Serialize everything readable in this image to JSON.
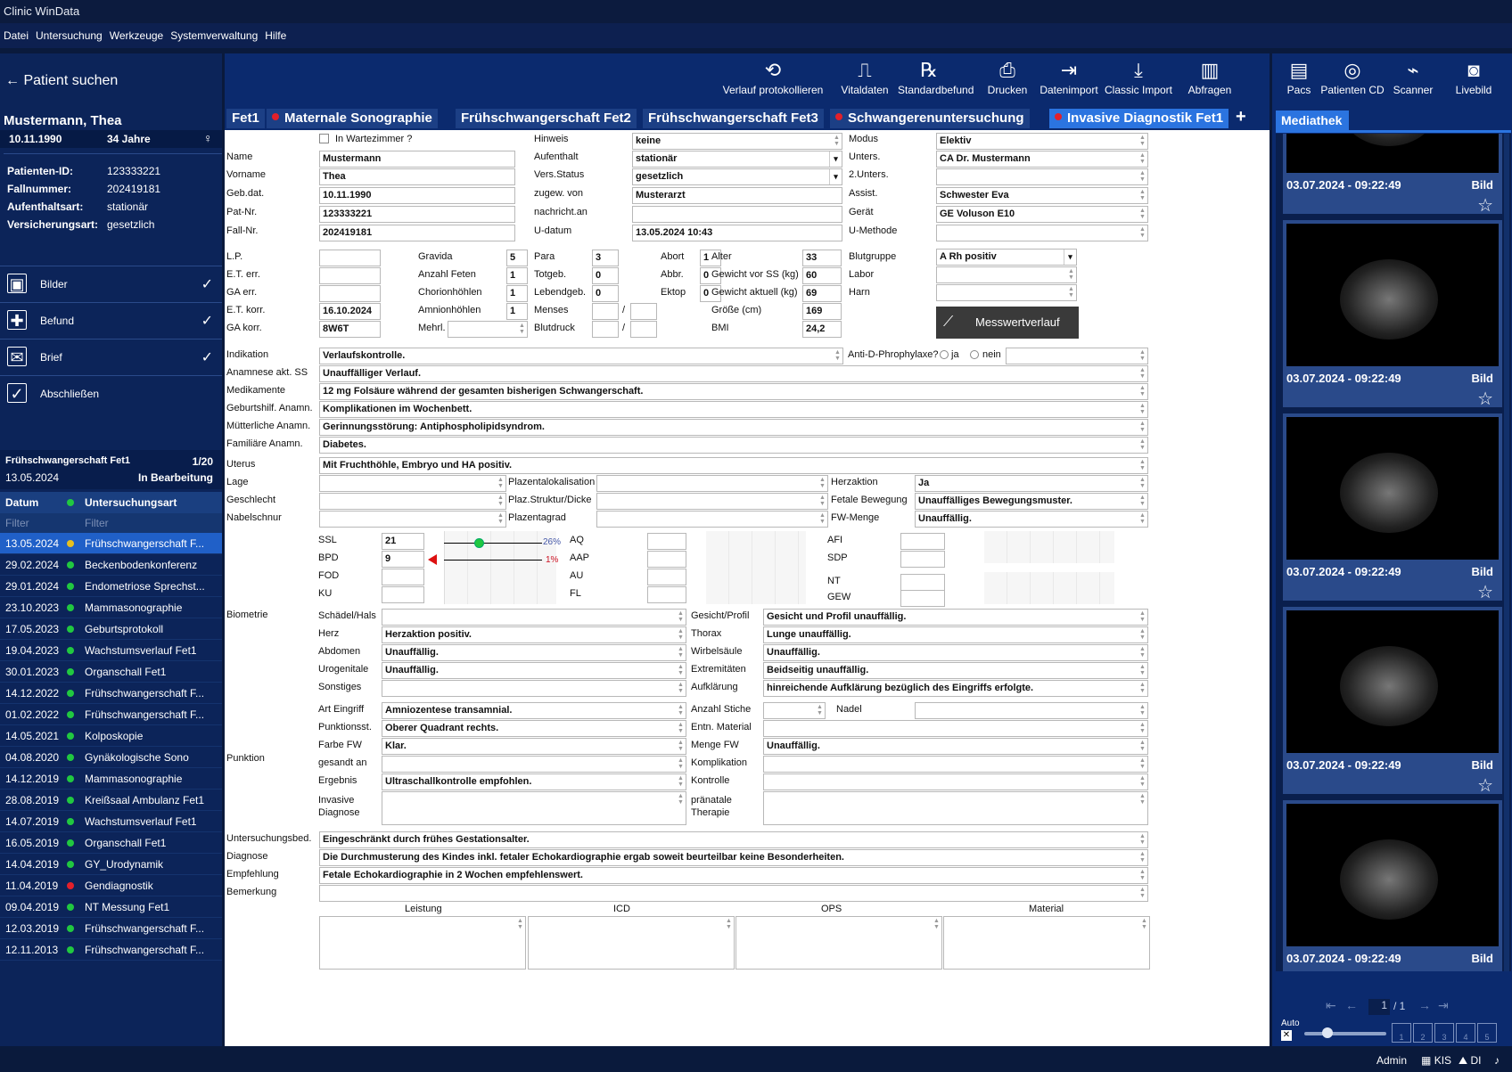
{
  "app": {
    "title": "Clinic WinData"
  },
  "menu": [
    "Datei",
    "Untersuchung",
    "Werkzeuge",
    "Systemverwaltung",
    "Hilfe"
  ],
  "sidebar": {
    "back": "Patient suchen",
    "patient_name": "Mustermann, Thea",
    "dob": "10.11.1990",
    "age": "34 Jahre",
    "details": [
      {
        "label": "Patienten-ID:",
        "value": "123333221"
      },
      {
        "label": "Fallnummer:",
        "value": "202419181"
      },
      {
        "label": "Aufenthaltsart:",
        "value": "stationär"
      },
      {
        "label": "Versicherungsart:",
        "value": "gesetzlich"
      }
    ],
    "nav": [
      {
        "label": "Bilder"
      },
      {
        "label": "Befund"
      },
      {
        "label": "Brief"
      },
      {
        "label": "Abschließen"
      }
    ],
    "visit": {
      "title": "Frühschwangerschaft Fet1",
      "count": "1/20",
      "date": "13.05.2024",
      "status": "In Bearbeitung"
    },
    "history_head": {
      "date": "Datum",
      "type": "Untersuchungsart"
    },
    "filter": "Filter",
    "history": [
      {
        "date": "13.05.2024",
        "type": "Frühschwangerschaft F...",
        "color": "#e6c020"
      },
      {
        "date": "29.02.2024",
        "type": "Beckenbodenkonferenz",
        "color": "#21c840"
      },
      {
        "date": "29.01.2024",
        "type": "Endometriose Sprechst...",
        "color": "#21c840"
      },
      {
        "date": "23.10.2023",
        "type": "Mammasonographie",
        "color": "#21c840"
      },
      {
        "date": "17.05.2023",
        "type": "Geburtsprotokoll",
        "color": "#21c840"
      },
      {
        "date": "19.04.2023",
        "type": "Wachstumsverlauf Fet1",
        "color": "#21c840"
      },
      {
        "date": "30.01.2023",
        "type": "Organschall Fet1",
        "color": "#21c840"
      },
      {
        "date": "14.12.2022",
        "type": "Frühschwangerschaft F...",
        "color": "#21c840"
      },
      {
        "date": "01.02.2022",
        "type": "Frühschwangerschaft F...",
        "color": "#21c840"
      },
      {
        "date": "14.05.2021",
        "type": "Kolposkopie",
        "color": "#21c840"
      },
      {
        "date": "04.08.2020",
        "type": "Gynäkologische Sono",
        "color": "#21c840"
      },
      {
        "date": "14.12.2019",
        "type": "Mammasonographie",
        "color": "#21c840"
      },
      {
        "date": "28.08.2019",
        "type": "Kreißsaal Ambulanz Fet1",
        "color": "#21c840"
      },
      {
        "date": "14.07.2019",
        "type": "Wachstumsverlauf Fet1",
        "color": "#21c840"
      },
      {
        "date": "16.05.2019",
        "type": "Organschall Fet1",
        "color": "#21c840"
      },
      {
        "date": "14.04.2019",
        "type": "GY_Urodynamik",
        "color": "#21c840"
      },
      {
        "date": "11.04.2019",
        "type": "Gendiagnostik",
        "color": "#e3202a"
      },
      {
        "date": "09.04.2019",
        "type": "NT Messung Fet1",
        "color": "#21c840"
      },
      {
        "date": "12.03.2019",
        "type": "Frühschwangerschaft F...",
        "color": "#21c840"
      },
      {
        "date": "12.11.2013",
        "type": "Frühschwangerschaft F...",
        "color": "#21c840"
      }
    ]
  },
  "toolbar": [
    {
      "label": "Verlauf protokollieren",
      "icon": "history-icon",
      "g": "⟲"
    },
    {
      "label": "Vitaldaten",
      "icon": "vitals-icon",
      "g": "⎍"
    },
    {
      "label": "Standardbefund",
      "icon": "prescription-icon",
      "g": "℞"
    },
    {
      "label": "Drucken",
      "icon": "printer-icon",
      "g": "⎙"
    },
    {
      "label": "Datenimport",
      "icon": "import-icon",
      "g": "⇥"
    },
    {
      "label": "Classic Import",
      "icon": "download-icon",
      "g": "⤓"
    },
    {
      "label": "Abfragen",
      "icon": "chart-icon",
      "g": "▥"
    }
  ],
  "right_toolbar": [
    {
      "label": "Pacs",
      "icon": "pacs-icon",
      "g": "▤"
    },
    {
      "label": "Patienten CD",
      "icon": "cd-icon",
      "g": "◎"
    },
    {
      "label": "Scanner",
      "icon": "scanner-icon",
      "g": "⌁"
    },
    {
      "label": "Livebild",
      "icon": "camera-icon",
      "g": "◙"
    }
  ],
  "tabs": [
    {
      "label": "Fet1",
      "dot": false
    },
    {
      "label": "Maternale Sonographie",
      "dot": true
    },
    {
      "label": "Frühschwangerschaft Fet2",
      "dot": false
    },
    {
      "label": "Frühschwangerschaft Fet3",
      "dot": false
    },
    {
      "label": "Schwangerenuntersuchung",
      "dot": true
    },
    {
      "label": "Invasive Diagnostik Fet1",
      "dot": true
    }
  ],
  "form": {
    "wartezimmer": "In Wartezimmer ?",
    "name_l": "Name",
    "name": "Mustermann",
    "vorname_l": "Vorname",
    "vorname": "Thea",
    "gebdat_l": "Geb.dat.",
    "gebdat": "10.11.1990",
    "patnr_l": "Pat-Nr.",
    "patnr": "123333221",
    "fallnr_l": "Fall-Nr.",
    "fallnr": "202419181",
    "hinweis_l": "Hinweis",
    "hinweis": "keine",
    "aufenthalt_l": "Aufenthalt",
    "aufenthalt": "stationär",
    "vers_l": "Vers.Status",
    "vers": "gesetzlich",
    "zugew_l": "zugew. von",
    "zugew": "Musterarzt",
    "nachricht_l": "nachricht.an",
    "nachricht": "",
    "udatum_l": "U-datum",
    "udatum": "13.05.2024 10:43",
    "modus_l": "Modus",
    "modus": "Elektiv",
    "unters_l": "Unters.",
    "unters": "CA Dr. Mustermann",
    "unters2_l": "2.Unters.",
    "unters2": "",
    "assist_l": "Assist.",
    "assist": "Schwester Eva",
    "geraet_l": "Gerät",
    "geraet": "GE Voluson E10",
    "umethode_l": "U-Methode",
    "umethode": "",
    "lp_l": "L.P.",
    "eterr_l": "E.T. err.",
    "gaerr_l": "GA err.",
    "etkorr_l": "E.T. korr.",
    "etkorr": "16.10.2024",
    "gakorr_l": "GA korr.",
    "gakorr": "8W6T",
    "gravida_l": "Gravida",
    "gravida": "5",
    "feten_l": "Anzahl Feten",
    "feten": "1",
    "chorion_l": "Chorionhöhlen",
    "chorion": "1",
    "amnion_l": "Amnionhöhlen",
    "amnion": "1",
    "mehrl_l": "Mehrl.",
    "para_l": "Para",
    "para": "3",
    "totgeb_l": "Totgeb.",
    "totgeb": "0",
    "lebend_l": "Lebendgeb.",
    "lebend": "0",
    "menses_l": "Menses",
    "blutdruck_l": "Blutdruck",
    "abort_l": "Abort",
    "abort": "1",
    "abbr_l": "Abbr.",
    "abbr": "0",
    "ektop_l": "Ektop",
    "ektop": "0",
    "alter_l": "Alter",
    "alter": "33",
    "gewss_l": "Gewicht vor SS (kg)",
    "gewss": "60",
    "gewakt_l": "Gewicht aktuell (kg)",
    "gewakt": "69",
    "groesse_l": "Größe (cm)",
    "groesse": "169",
    "bmi_l": "BMI",
    "bmi": "24,2",
    "blutgruppe_l": "Blutgruppe",
    "blutgruppe": "A Rh positiv",
    "labor_l": "Labor",
    "harn_l": "Harn",
    "messwert": "Messwertverlauf",
    "indikation_l": "Indikation",
    "indikation": "Verlaufskontrolle.",
    "antid_l": "Anti-D-Phrophylaxe?",
    "ja": "ja",
    "nein": "nein",
    "anamnese_l": "Anamnese akt. SS",
    "anamnese": "Unauffälliger Verlauf.",
    "medikamente_l": "Medikamente",
    "medikamente": "12 mg Folsäure während der gesamten bisherigen Schwangerschaft.",
    "geburtshilf_l": "Geburtshilf. Anamn.",
    "geburtshilf": "Komplikationen im Wochenbett.",
    "muetter_l": "Mütterliche Anamn.",
    "muetter": "Gerinnungsstörung: Antiphospholipidsyndrom.",
    "familiaer_l": "Familiäre Anamn.",
    "familiaer": "Diabetes.",
    "uterus_l": "Uterus",
    "uterus": "Mit Fruchthöhle, Embryo und HA positiv.",
    "lage_l": "Lage",
    "geschlecht_l": "Geschlecht",
    "nabel_l": "Nabelschnur",
    "plazloc_l": "Plazentalokalisation",
    "plazstr_l": "Plaz.Struktur/Dicke",
    "plazgrad_l": "Plazentagrad",
    "herzaktion_l": "Herzaktion",
    "herzaktion": "Ja",
    "fetbew_l": "Fetale Bewegung",
    "fetbew": "Unauffälliges Bewegungsmuster.",
    "fwmenge_l": "FW-Menge",
    "fwmenge": "Unauffällig.",
    "ssl_l": "SSL",
    "ssl": "21",
    "ssl_pct": "26%",
    "bpd_l": "BPD",
    "bpd": "9",
    "bpd_pct": "1%",
    "fod_l": "FOD",
    "ku_l": "KU",
    "aq_l": "AQ",
    "aap_l": "AAP",
    "au_l": "AU",
    "fl_l": "FL",
    "afi_l": "AFI",
    "sdp_l": "SDP",
    "nt_l": "NT",
    "gew_l": "GEW",
    "biometrie_l": "Biometrie",
    "schaedel_l": "Schädel/Hals",
    "schaedel": "",
    "herz_l": "Herz",
    "herz": "Herzaktion positiv.",
    "abdomen_l": "Abdomen",
    "abdomen": "Unauffällig.",
    "urogenitale_l": "Urogenitale",
    "urogenitale": "Unauffällig.",
    "sonstiges_l": "Sonstiges",
    "sonstiges": "",
    "gesicht_l": "Gesicht/Profil",
    "gesicht": "Gesicht und Profil unauffällig.",
    "thorax_l": "Thorax",
    "thorax": "Lunge unauffällig.",
    "wirbel_l": "Wirbelsäule",
    "wirbel": "Unauffällig.",
    "extrem_l": "Extremitäten",
    "extrem": "Beidseitig unauffällig.",
    "aufkl_l": "Aufklärung",
    "aufkl": "hinreichende Aufklärung bezüglich des Eingriffs erfolgte.",
    "punktion_l": "Punktion",
    "arteingriff_l": "Art Eingriff",
    "arteingriff": "Amniozentese transamnial.",
    "punktionsst_l": "Punktionsst.",
    "punktionsst": "Oberer Quadrant rechts.",
    "farbefw_l": "Farbe FW",
    "farbefw": "Klar.",
    "gesandt_l": "gesandt an",
    "gesandt": "",
    "ergebnis_l": "Ergebnis",
    "ergebnis": "Ultraschallkontrolle empfohlen.",
    "invasive_l1": "Invasive",
    "invasive_l2": "Diagnose",
    "stiche_l": "Anzahl Stiche",
    "nadel_l": "Nadel",
    "entn_l": "Entn. Material",
    "mengefw_l": "Menge FW",
    "mengefw": "Unauffällig.",
    "kompl_l": "Komplikation",
    "kontrolle_l": "Kontrolle",
    "praenatal_l1": "pränatale",
    "praenatal_l2": "Therapie",
    "ubed_l": "Untersuchungsbed.",
    "ubed": "Eingeschränkt durch frühes Gestationsalter.",
    "diagnose_l": "Diagnose",
    "diagnose": "Die Durchmusterung des Kindes inkl. fetaler Echokardiographie ergab soweit beurteilbar keine Besonderheiten.",
    "empfehlung_l": "Empfehlung",
    "empfehlung": "Fetale Echokardiographie in 2 Wochen empfehlenswert.",
    "bemerkung_l": "Bemerkung",
    "leistung_l": "Leistung",
    "icd_l": "ICD",
    "ops_l": "OPS",
    "material_l": "Material"
  },
  "mediathek": {
    "tab": "Mediathek",
    "items": [
      {
        "date": "03.07.2024 - 09:22:49",
        "type": "Bild"
      },
      {
        "date": "03.07.2024 - 09:22:49",
        "type": "Bild"
      },
      {
        "date": "03.07.2024 - 09:22:49",
        "type": "Bild"
      },
      {
        "date": "03.07.2024 - 09:22:49",
        "type": "Bild"
      },
      {
        "date": "03.07.2024 - 09:22:49",
        "type": "Bild"
      }
    ],
    "page": "1",
    "pages": "/ 1",
    "auto": "Auto",
    "layouts": [
      "1",
      "2",
      "3",
      "4",
      "5"
    ]
  },
  "status": {
    "user": "Admin",
    "kis": "KIS",
    "di": "DI"
  }
}
